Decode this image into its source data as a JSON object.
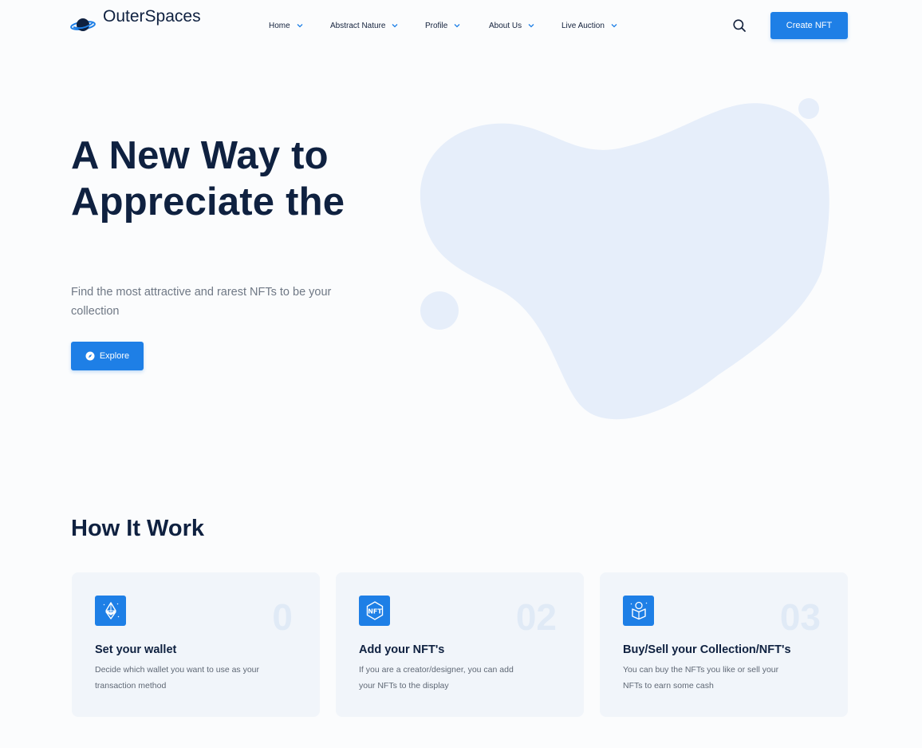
{
  "brand": {
    "name": "OuterSpaces",
    "accent": "#1e7fe6",
    "dark": "#0f2140"
  },
  "nav": {
    "items": [
      {
        "label": "Home"
      },
      {
        "label": "Abstract Nature"
      },
      {
        "label": "Profile"
      },
      {
        "label": "About Us"
      },
      {
        "label": "Live Auction"
      }
    ],
    "search_icon": "search-icon",
    "create_label": "Create NFT"
  },
  "hero": {
    "title_line1": "A New Way to",
    "title_line2": "Appreciate the",
    "subtitle": "Find the most attractive and rarest NFTs to be your collection",
    "explore_label": "Explore",
    "explore_icon": "compass-icon",
    "blob_color": "#e6eefa"
  },
  "how": {
    "title": "How It Work",
    "cards": [
      {
        "number": "0",
        "title": "Set your wallet",
        "desc": "Decide which wallet you want to use as your transaction method",
        "icon": "ethereum-icon"
      },
      {
        "number": "02",
        "title": "Add your NFT's",
        "desc": "If you are a creator/designer, you can add your NFTs to the display",
        "icon": "nft-icon"
      },
      {
        "number": "03",
        "title": "Buy/Sell your Collection/NFT's",
        "desc": "You can buy the NFTs you like or sell your NFTs to earn some cash",
        "icon": "box-icon"
      }
    ]
  }
}
